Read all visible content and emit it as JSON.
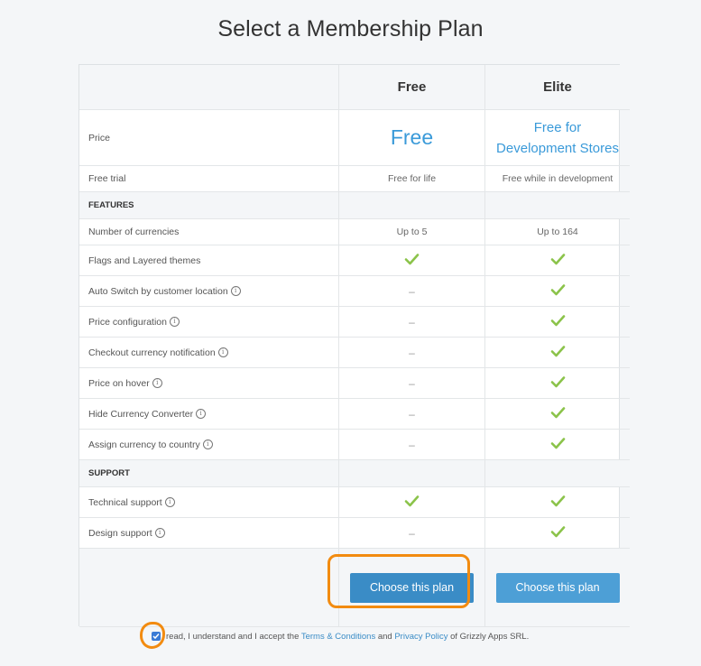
{
  "page": {
    "title": "Select a Membership Plan"
  },
  "plans": {
    "free_name": "Free",
    "elite_name": "Elite",
    "price_label": "Price",
    "free_price": "Free",
    "elite_price_line1": "Free for",
    "elite_price_line2": "Development Stores",
    "trial_label": "Free trial",
    "free_trial": "Free for life",
    "elite_trial": "Free while in development"
  },
  "features": {
    "section_label": "FEATURES",
    "rows": [
      {
        "label": "Number of currencies",
        "free": "Up to 5",
        "elite": "Up to 164"
      },
      {
        "label": "Flags and Layered themes",
        "free": "check",
        "elite": "check"
      },
      {
        "label": "Auto Switch by customer location",
        "free": "–",
        "elite": "check"
      },
      {
        "label": "Price configuration",
        "free": "–",
        "elite": "check"
      },
      {
        "label": "Checkout currency notification",
        "free": "–",
        "elite": "check"
      },
      {
        "label": "Price on hover",
        "free": "–",
        "elite": "check"
      },
      {
        "label": "Hide Currency Converter",
        "free": "–",
        "elite": "check"
      },
      {
        "label": "Assign currency to country",
        "free": "–",
        "elite": "check"
      }
    ]
  },
  "support": {
    "section_label": "SUPPORT",
    "rows": [
      {
        "label": "Technical support",
        "free": "check",
        "elite": "check"
      },
      {
        "label": "Design support",
        "free": "–",
        "elite": "check"
      }
    ]
  },
  "buttons": {
    "free_choose": "Choose this plan",
    "elite_choose": "Choose this plan"
  },
  "accept": {
    "text_before": "read, I understand and I accept the",
    "terms_link": "Terms & Conditions",
    "and": "and",
    "privacy_link": "Privacy Policy",
    "text_after": "of Grizzly Apps SRL."
  },
  "colors": {
    "accent": "#3a9ad9",
    "check": "#8bc34a",
    "highlight": "#f28b10"
  }
}
